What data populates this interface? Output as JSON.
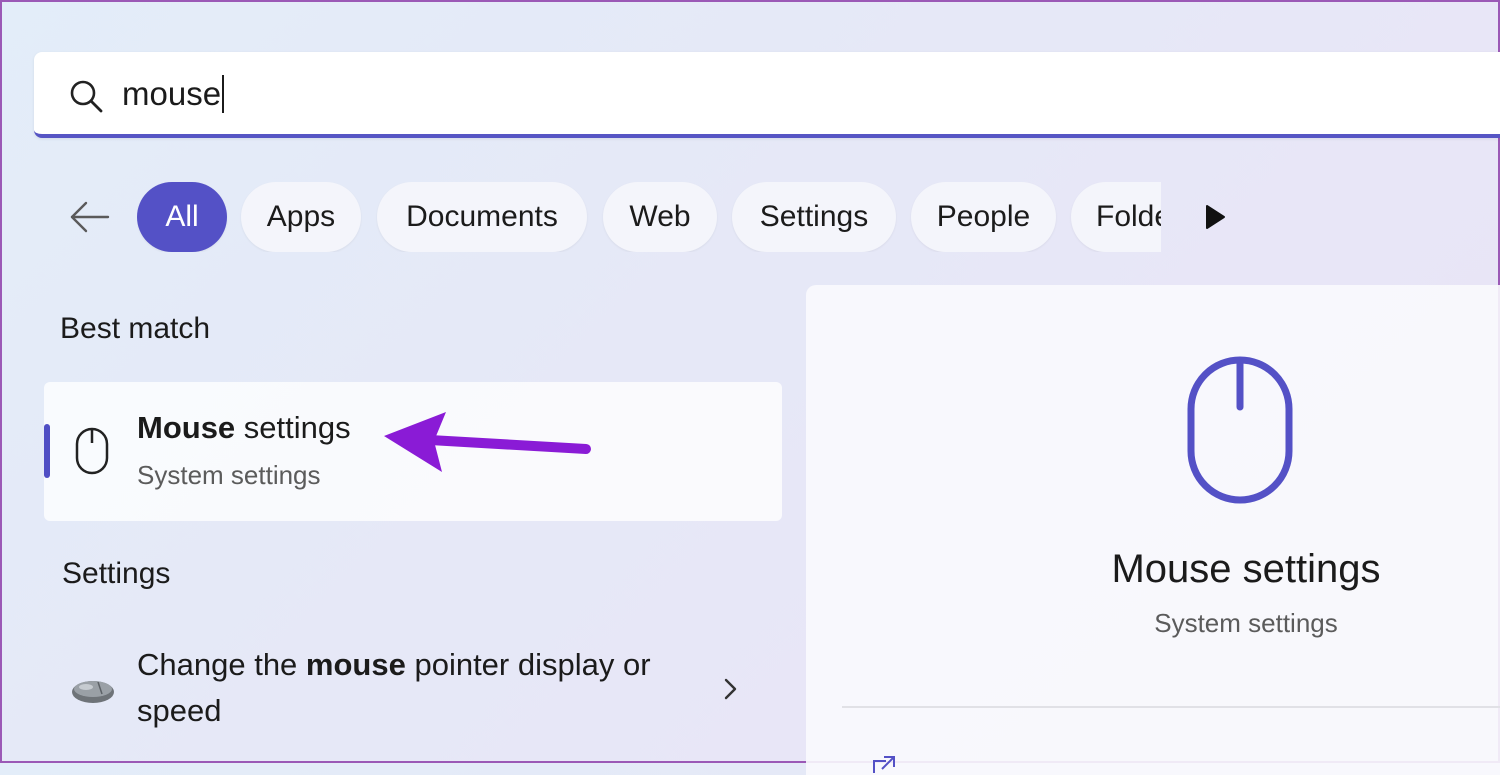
{
  "search": {
    "value": "mouse",
    "icon": "search-icon"
  },
  "filters": {
    "back_icon": "back-arrow-icon",
    "items": [
      {
        "label": "All",
        "active": true
      },
      {
        "label": "Apps",
        "active": false
      },
      {
        "label": "Documents",
        "active": false
      },
      {
        "label": "Web",
        "active": false
      },
      {
        "label": "Settings",
        "active": false
      },
      {
        "label": "People",
        "active": false
      },
      {
        "label": "Folde",
        "active": false
      }
    ],
    "more_icon": "play-arrow-icon"
  },
  "best_match": {
    "heading": "Best match",
    "item": {
      "title_bold": "Mouse",
      "title_rest": " settings",
      "subtitle": "System settings",
      "icon": "mouse-outline-icon"
    }
  },
  "settings_section": {
    "heading": "Settings",
    "items": [
      {
        "text_pre": "Change the ",
        "text_bold": "mouse",
        "text_post": " pointer display or speed",
        "icon": "mouse-gray-icon"
      }
    ]
  },
  "preview": {
    "title": "Mouse settings",
    "subtitle": "System settings",
    "icon": "mouse-outline-icon"
  },
  "colors": {
    "accent": "#5451c6",
    "annotation": "#8a1bd6"
  }
}
